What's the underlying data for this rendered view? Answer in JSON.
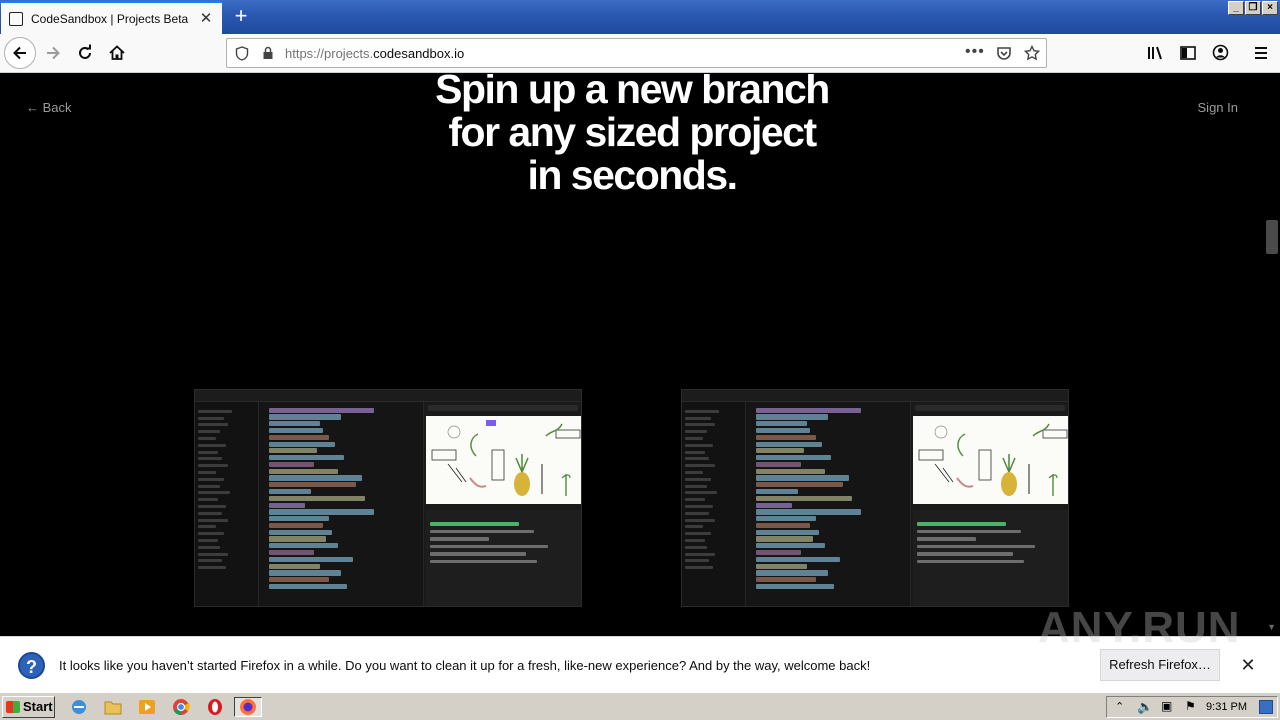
{
  "browser": {
    "tab_title": "CodeSandbox | Projects Beta - Dev",
    "url_prefix": "https://projects.",
    "url_domain": "codesandbox.io",
    "url_full": "https://projects.codesandbox.io"
  },
  "page": {
    "back_label": "← Back",
    "signin_label": "Sign In",
    "hero_lines": [
      "Spin up a new branch",
      "for any sized project",
      "in seconds."
    ]
  },
  "notification": {
    "text": "It looks like you haven’t started Firefox in a while. Do you want to clean it up for a fresh, like-new experience? And by the way, welcome back!",
    "button_label": "Refresh Firefox…",
    "watermark": "ANY.RUN"
  },
  "taskbar": {
    "start_label": "Start",
    "clock": "9:31 PM"
  },
  "colors": {
    "accent": "#0a84ff",
    "page_bg": "#000000",
    "hero_text": "#ffffff"
  }
}
